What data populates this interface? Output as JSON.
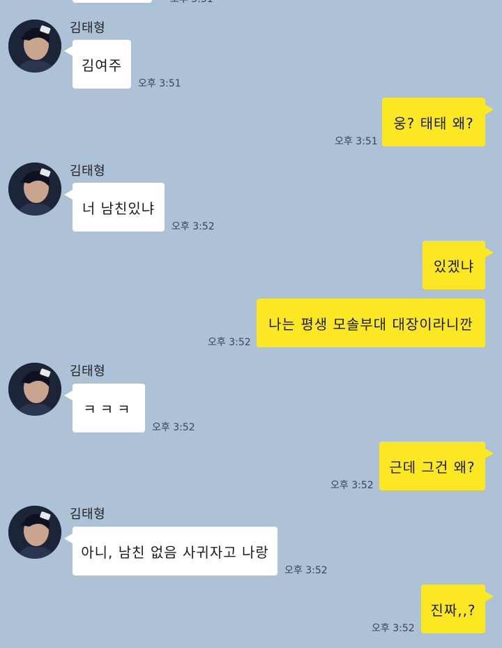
{
  "top_partial": {
    "time": "오후 3:51"
  },
  "sender": {
    "name": "김태형"
  },
  "messages": [
    {
      "side": "left",
      "text": "김여주",
      "time": "오후 3:51"
    },
    {
      "side": "right",
      "text": "웅? 태태 왜?",
      "time": "오후 3:51"
    },
    {
      "side": "left",
      "text": "너 남친있냐",
      "time": "오후 3:52"
    },
    {
      "side": "right",
      "text": "있겠냐",
      "time": ""
    },
    {
      "side": "right",
      "text": "나는 평생 모솔부대 대장이라니깐",
      "time": "오후 3:52"
    },
    {
      "side": "left",
      "text": "ㅋㅋㅋ",
      "time": "오후 3:52"
    },
    {
      "side": "right",
      "text": "근데 그건 왜?",
      "time": "오후 3:52"
    },
    {
      "side": "left",
      "text": "아니, 남친 없음 사귀자고 나랑",
      "time": "오후 3:52"
    },
    {
      "side": "right",
      "text": "진짜,,?",
      "time": "오후 3:52"
    }
  ],
  "colors": {
    "background": "#adc2d6",
    "incoming_bubble": "#ffffff",
    "outgoing_bubble": "#fce822"
  },
  "icons": {
    "avatar": "profile-photo"
  }
}
